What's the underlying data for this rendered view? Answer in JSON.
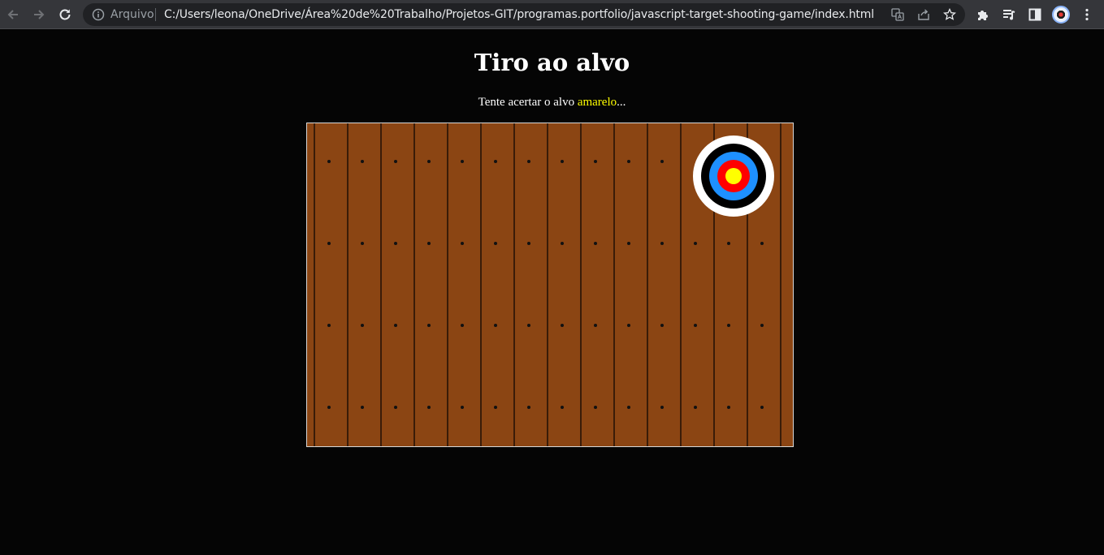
{
  "browser": {
    "scheme_label": "Arquivo",
    "url": "C:/Users/leona/OneDrive/Área%20de%20Trabalho/Projetos-GIT/programas.portfolio/javascript-target-shooting-game/index.html",
    "icons": {
      "back": "arrow-left-icon",
      "forward": "arrow-right-icon",
      "reload": "reload-icon",
      "info": "info-icon",
      "translate": "translate-icon",
      "share": "share-icon",
      "bookmark": "star-icon",
      "extensions": "puzzle-icon",
      "media": "media-queue-icon",
      "side_panel": "side-panel-icon",
      "profile": "profile-avatar-icon",
      "menu": "kebab-menu-icon"
    }
  },
  "page": {
    "title": "Tiro ao alvo",
    "instruction_prefix": "Tente acertar o alvo ",
    "instruction_highlight": "amarelo",
    "instruction_suffix": "..."
  },
  "colors": {
    "background": "#050505",
    "board": "#8b4513",
    "highlight": "#ffff00",
    "target_rings": [
      "#ffffff",
      "#000000",
      "#1e90ff",
      "#ff0000",
      "#ffff00"
    ]
  }
}
